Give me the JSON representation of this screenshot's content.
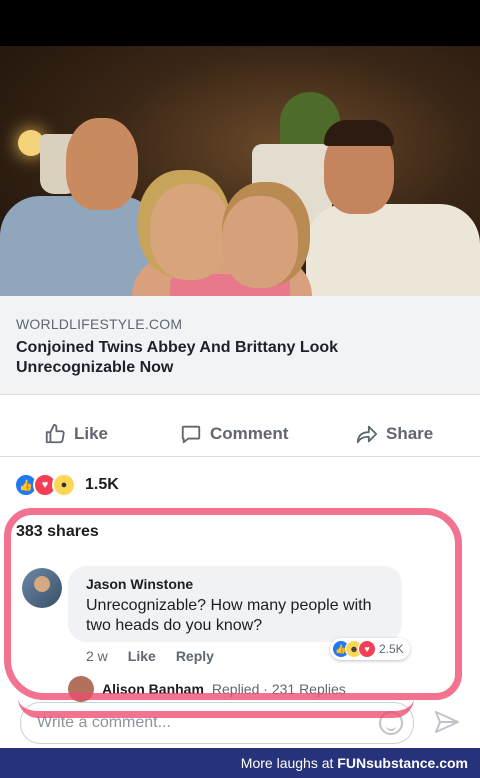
{
  "post": {
    "link": {
      "domain": "WORLDLIFESTYLE.COM",
      "title": "Conjoined Twins Abbey And Brittany Look Unrecognizable Now"
    },
    "actions": {
      "like": "Like",
      "comment": "Comment",
      "share": "Share"
    },
    "reactions": {
      "icons": [
        "like-icon",
        "love-icon",
        "wow-icon"
      ],
      "count": "1.5K"
    },
    "shares": "383 shares"
  },
  "comment": {
    "author": "Jason Winstone",
    "text": "Unrecognizable? How many people with two heads do you know?",
    "time": "2 w",
    "like": "Like",
    "reply": "Reply",
    "reactions": {
      "icons": [
        "like-icon",
        "haha-icon",
        "love-icon"
      ],
      "count": "2.5K"
    },
    "replies": {
      "name": "Alison Banham",
      "text": "Replied · 231 Replies"
    }
  },
  "composer": {
    "placeholder": "Write a comment..."
  },
  "footer": {
    "prefix": "More laughs at ",
    "brand": "FUNsubstance.com"
  },
  "colors": {
    "facebook_blue": "#2078f4",
    "love_red": "#f33e58",
    "annotation_pink": "#ee4a70",
    "footer_bg": "#26327a"
  }
}
